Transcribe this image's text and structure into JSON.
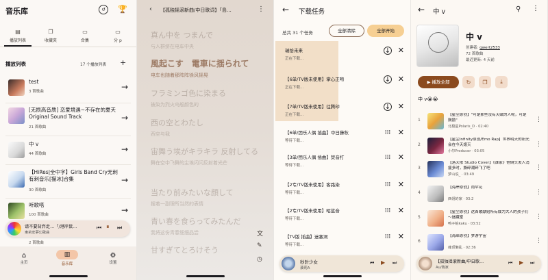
{
  "library": {
    "title": "音乐库",
    "tabs": [
      {
        "label": "播放列表",
        "icon": "playlist-icon"
      },
      {
        "label": "收藏夹",
        "icon": "favorites-icon"
      },
      {
        "label": "合集",
        "icon": "collection-icon"
      },
      {
        "label": "分 p",
        "icon": "folder-icon"
      }
    ],
    "section_title": "播放列表",
    "count_label": "17 个播放列表",
    "playlists": [
      {
        "name": "test",
        "sub": "3 首歌曲"
      },
      {
        "name": "[无损高音质] 恋爱境遇~不存在的夏天 Original Sound Track",
        "sub": "21 首歌曲"
      },
      {
        "name": "中 v",
        "sub": "44 首歌曲"
      },
      {
        "name": "【HiRes|全中字】Girls Band Cry无刺有刺音乐[猫冰]合集",
        "sub": "30 首歌曲"
      },
      {
        "name": "听歌嗒",
        "sub": "100 首歌曲"
      },
      {
        "name": "",
        "sub": "2 首歌曲"
      }
    ],
    "mini_player": {
      "title": "请不要背弃走…「/港岸鼠…",
      "artist": "東莉安夢幻歌曲"
    },
    "nav": [
      {
        "label": "主页",
        "icon": "home-icon"
      },
      {
        "label": "音乐库",
        "icon": "library-icon"
      },
      {
        "label": "设置",
        "icon": "settings-icon"
      }
    ]
  },
  "lyrics": {
    "title": "【孤独摇滚新曲/中日歌词】「島…",
    "lines": [
      {
        "jp": "真ん中を つまんで",
        "cn": "与人群挤在电车中央"
      },
      {
        "jp": "風起こす　電車に揺られて",
        "cn": "电车也随着那阵阵徐风摇晃"
      },
      {
        "jp": "フラミンゴ色に染まる",
        "cn": "被染为烈火鸟般颜色的"
      },
      {
        "jp": "西の空とわたし",
        "cn": "西空与我"
      },
      {
        "jp": "宙舞う埃がキラキラ 反射してる",
        "cn": "舞在空中飞舞的尘埃闪闪反射着光芒"
      },
      {
        "jp": "当たり前みたいな顔して",
        "cn": "摆着一副理所当然的表情"
      },
      {
        "jp": "青い春を食らってみたんだ",
        "cn": "我将这份青春细细品尝"
      },
      {
        "jp": "甘すぎてとろけそう",
        "cn": "甜得仿佛要溶化掉"
      }
    ]
  },
  "downloads": {
    "title": "下载任务",
    "total": "总共 31 个任务",
    "clear_btn": "全部清除",
    "start_btn": "全部开始",
    "tasks": [
      {
        "name": "瑞拾未来",
        "state": "正在下载..."
      },
      {
        "name": "【6单/TV版未使用】掌心正吻",
        "state": "正在下载..."
      },
      {
        "name": "【7单/TV版未使用】往腾印",
        "state": "正在下载..."
      },
      {
        "name": "【6单/团乐人偶 插曲】中日藤秋",
        "state": "等待下载..."
      },
      {
        "name": "【3单/团乐人偶 插曲】焚音打",
        "state": "等待下载..."
      },
      {
        "name": "【2专/TV版未使用】客路染",
        "state": "等待下载..."
      },
      {
        "name": "【2专/TV版未使用】昭蓝音",
        "state": "等待下载..."
      },
      {
        "name": "【TV版 插曲】迷塞洞",
        "state": "等待下载..."
      }
    ],
    "mini_player": {
      "title": "秒針少女",
      "artist": "湊莉A"
    }
  },
  "playlist": {
    "title": "中 v",
    "heading": "中 v",
    "creator_label": "创建者:",
    "creator": "qwert2533",
    "count": "72 首歌曲",
    "updated": "最近更新: 4 天前",
    "play_all": "播放全部",
    "description": "中 v😭😭",
    "songs": [
      {
        "idx": "1",
        "title": "【星尘原创】\"可是那些没有天赋的人呢，可是鼓励\"",
        "sub": "北极星Polaris_D · 02:40"
      },
      {
        "idx": "2",
        "title": "【星尘Infinity原创/Emo Rap】世界明天的阳光会在今天熄灭",
        "sub": "小尔Producer · 03:05"
      },
      {
        "idx": "3",
        "title": "【洛天依 Studio Cover】《谁家》他倒头发人消瘦多时，撕碎潮碎飞了吧",
        "sub": "梦山说_ · 03:49"
      },
      {
        "idx": "4",
        "title": "【海岸原创】雨伞花",
        "sub": "西翎的家 · 03:2"
      },
      {
        "idx": "5",
        "title": "【星尘原创】这首歌献给所有成为大人的孩子们～迷藏室",
        "sub": "鸭子柏kaku · 03:52"
      },
      {
        "idx": "6",
        "title": "【海岸原创】梦游宇宙",
        "sub": "峰顶懒乱 · 02:36"
      }
    ],
    "mini_player": {
      "title": "【孤独摇滚新曲/中日歌…",
      "artist": "Au/我家"
    }
  },
  "colors": {
    "accent": "#8b4a1e",
    "highlight": "#f2dfc8",
    "lyric_active": "#9c7a64",
    "start_btn_bg": "#f6cf93"
  }
}
